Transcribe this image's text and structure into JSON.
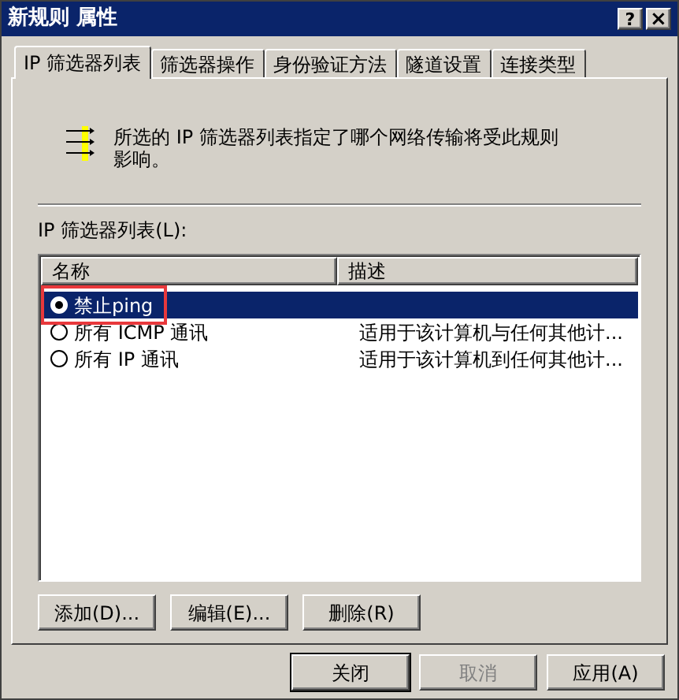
{
  "window": {
    "title": "新规则 属性",
    "help": "?",
    "close": "×"
  },
  "tabs": [
    {
      "label": "IP 筛选器列表",
      "selected": true
    },
    {
      "label": "筛选器操作",
      "selected": false
    },
    {
      "label": "身份验证方法",
      "selected": false
    },
    {
      "label": "隧道设置",
      "selected": false
    },
    {
      "label": "连接类型",
      "selected": false
    }
  ],
  "description": "所选的 IP 筛选器列表指定了哪个网络传输将受此规则影响。",
  "list_label": "IP 筛选器列表(L):",
  "table": {
    "columns": [
      "名称",
      "描述"
    ],
    "rows": [
      {
        "name": "禁止ping",
        "description": "",
        "checked": true,
        "selected": true,
        "annotated": true
      },
      {
        "name": "所有 ICMP 通讯",
        "description": "适用于该计算机与任何其他计...",
        "checked": false,
        "selected": false,
        "annotated": false
      },
      {
        "name": "所有 IP 通讯",
        "description": "适用于该计算机到任何其他计...",
        "checked": false,
        "selected": false,
        "annotated": false
      }
    ]
  },
  "list_buttons": [
    "添加(D)...",
    "编辑(E)...",
    "删除(R)"
  ],
  "dialog_buttons": [
    {
      "label": "关闭",
      "disabled": false,
      "default": true
    },
    {
      "label": "取消",
      "disabled": true,
      "default": false
    },
    {
      "label": "应用(A)",
      "disabled": false,
      "default": false
    }
  ]
}
